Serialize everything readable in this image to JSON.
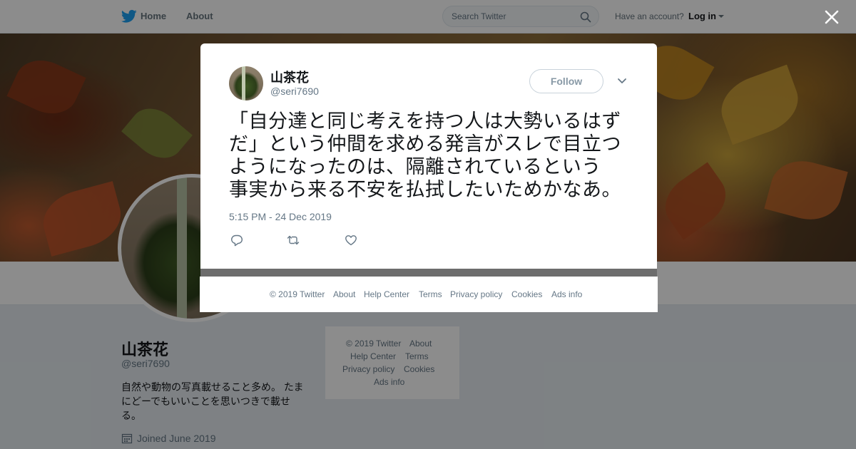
{
  "nav": {
    "home": "Home",
    "about": "About",
    "search_placeholder": "Search Twitter",
    "have_account": "Have an account?",
    "login": "Log in"
  },
  "profile": {
    "name": "山茶花",
    "handle": "@seri7690",
    "bio_lines": [
      "自然や動物の写真載せること多め。 たま",
      "にどーでもいいことを思いつきで載せ",
      "る。"
    ],
    "joined": "Joined June 2019"
  },
  "side_footer": {
    "copyright": "© 2019 Twitter",
    "about": "About",
    "help": "Help Center",
    "terms": "Terms",
    "privacy": "Privacy policy",
    "cookies": "Cookies",
    "ads": "Ads info"
  },
  "tweet": {
    "name": "山茶花",
    "handle": "@seri7690",
    "follow_label": "Follow",
    "text_lines": [
      "「自分達と同じ考えを持つ人は大勢いるはず",
      "だ」という仲間を求める発言がスレで目立つ",
      "ようになったのは、隔離されているという",
      "事実から来る不安を払拭したいためかなあ。"
    ],
    "timestamp": "5:15 PM - 24 Dec 2019",
    "actions": [
      "reply-icon",
      "retweet-icon",
      "like-icon"
    ]
  },
  "modal_footer": {
    "copyright": "© 2019 Twitter",
    "about": "About",
    "help": "Help Center",
    "terms": "Terms",
    "privacy": "Privacy policy",
    "cookies": "Cookies",
    "ads": "Ads info"
  },
  "colors": {
    "twitter_blue": "#1da1f2",
    "text_primary": "#14171a",
    "text_secondary": "#657786"
  }
}
